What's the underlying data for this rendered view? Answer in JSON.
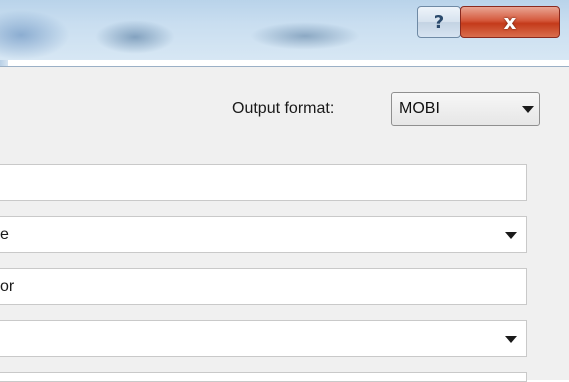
{
  "titlebar": {
    "help_label": "?",
    "close_label": "x"
  },
  "output": {
    "label": "Output format:",
    "selected": "MOBI"
  },
  "fields": [
    {
      "type": "text",
      "value": ""
    },
    {
      "type": "combo",
      "value": "e"
    },
    {
      "type": "text",
      "value": "or"
    },
    {
      "type": "combo",
      "value": ""
    }
  ]
}
